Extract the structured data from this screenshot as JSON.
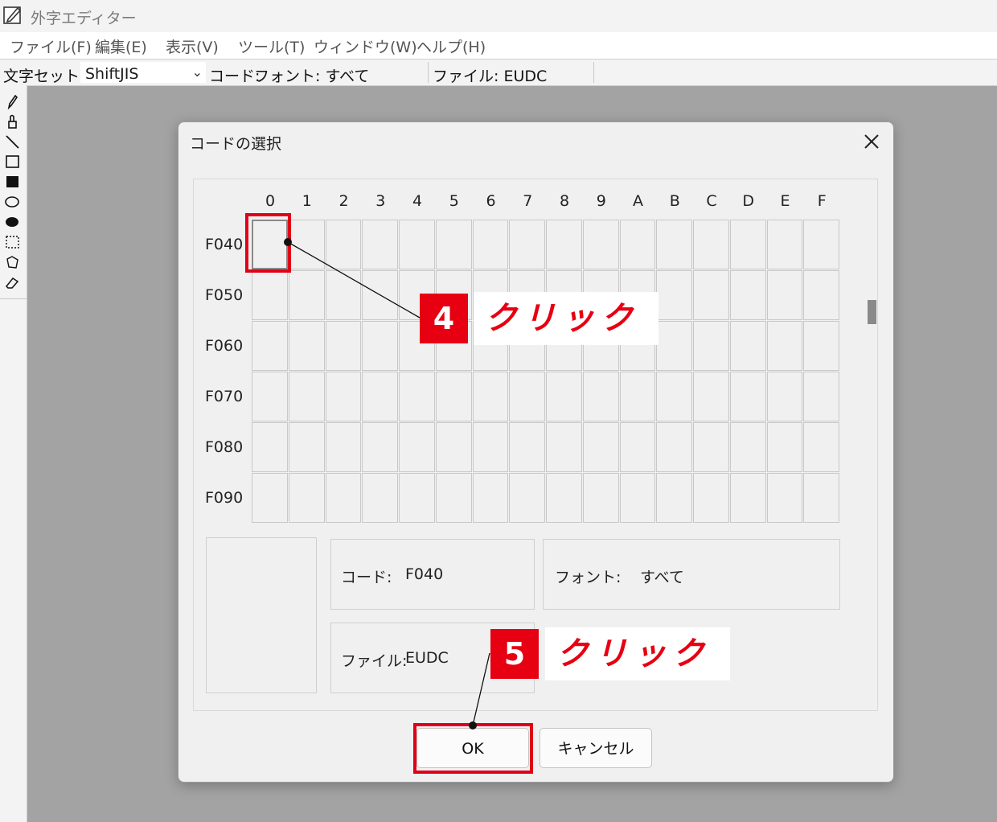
{
  "window": {
    "title": "外字エディター"
  },
  "menu": [
    "ファイル(F)",
    "編集(E)",
    "表示(V)",
    "ツール(T)",
    "ウィンドウ(W)",
    "ヘルプ(H)"
  ],
  "toolbar": {
    "charset_label": "文字セット:",
    "charset_value": "ShiftJIS",
    "code_label": "コード:",
    "font_label": "フォント: すべて",
    "file_label": "ファイル: EUDC"
  },
  "tools": [
    "pencil-icon",
    "brush-icon",
    "line-icon",
    "rectangle-icon",
    "filled-rectangle-icon",
    "ellipse-icon",
    "filled-ellipse-icon",
    "rect-select-icon",
    "freeform-select-icon",
    "eraser-icon"
  ],
  "dialog": {
    "title": "コードの選択",
    "columns": [
      "0",
      "1",
      "2",
      "3",
      "4",
      "5",
      "6",
      "7",
      "8",
      "9",
      "A",
      "B",
      "C",
      "D",
      "E",
      "F"
    ],
    "rows": [
      "F040",
      "F050",
      "F060",
      "F070",
      "F080",
      "F090"
    ],
    "selected_cell": {
      "row": 0,
      "col": 0
    },
    "info": {
      "code_label": "コード:",
      "code_value": "F040",
      "font_label": "フォント:",
      "font_value": "すべて",
      "file_label": "ファイル:",
      "file_value": "EUDC"
    },
    "ok_label": "OK",
    "cancel_label": "キャンセル"
  },
  "annotations": [
    {
      "number": "4",
      "text": "クリック"
    },
    {
      "number": "5",
      "text": "クリック"
    }
  ],
  "colors": {
    "accent_red": "#e60012"
  }
}
